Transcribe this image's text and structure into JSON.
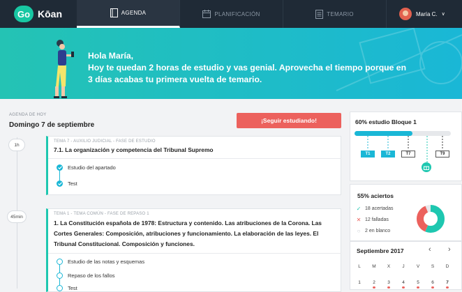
{
  "brand": {
    "badge": "Go",
    "name": "Kōan"
  },
  "nav": {
    "tabs": [
      {
        "label": "AGENDA",
        "icon": "book-icon",
        "active": true
      },
      {
        "label": "PLANIFICACIÓN",
        "icon": "calendar-icon",
        "active": false
      },
      {
        "label": "TEMARIO",
        "icon": "document-list-icon",
        "active": false
      }
    ],
    "user": {
      "name": "María C.",
      "caret": "∨"
    }
  },
  "hero": {
    "line1": "Hola María,",
    "line2": "Hoy te quedan 2 horas de estudio y vas genial. Aprovecha el tiempo porque en",
    "line3": "3 días acabas tu primera vuelta de temario."
  },
  "agenda": {
    "subtitle": "AGENDA DE HOY",
    "date": "Domingo 7 de septiembre",
    "continue_button": "¡Seguir estudiando!"
  },
  "sessions": [
    {
      "time": "1h",
      "meta": "TEMA 7 - AUXILIO JUDICIAL - FASE DE ESTUDIO",
      "title": "7.1.  La organización y competencia del Tribunal Supremo",
      "tasks": [
        {
          "label": "Estudio del apartado",
          "done": true
        },
        {
          "label": "Test",
          "done": true
        }
      ]
    },
    {
      "time": "45min",
      "meta": "TEMA 1 - TEMA COMÚN - FASE DE REPASO 1",
      "title_lines": [
        "1. La Constitución española de 1978: Estructura y contenido. Las atribuciones de la Corona. Las",
        "Cortes Generales: Composición, atribuciones y funcionamiento. La elaboración de las leyes. El",
        "Tribunal Constitucional. Composición y funciones."
      ],
      "tasks": [
        {
          "label": "Estudio de las notas y esquemas",
          "done": false
        },
        {
          "label": "Repaso de los fallos",
          "done": false
        },
        {
          "label": "Test",
          "done": false
        }
      ]
    }
  ],
  "study_progress": {
    "title": "60% estudio Bloque 1",
    "percent": 60,
    "milestones": [
      "T1",
      "T2",
      "T7",
      "T9"
    ],
    "accent": "#1ab7d6"
  },
  "accuracy": {
    "title": "55% aciertos",
    "correct": "18 acertadas",
    "failed": "12 falladas",
    "blank": "2 en blanco",
    "chart_data": {
      "type": "pie",
      "categories": [
        "acertadas",
        "falladas",
        "en blanco"
      ],
      "values": [
        18,
        12,
        2
      ],
      "colors": [
        "#1ec7b0",
        "#ec615d",
        "#e6e8eb"
      ]
    }
  },
  "calendar": {
    "month": "Septiembre 2017",
    "weekdays": [
      "L",
      "M",
      "X",
      "J",
      "V",
      "S",
      "D"
    ],
    "first_row": [
      "1",
      "2",
      "3",
      "4",
      "5",
      "6",
      "7"
    ]
  },
  "colors": {
    "teal": "#1ec7b0",
    "blue": "#1ab7d6",
    "red": "#ec615d",
    "nav": "#1f2a36"
  }
}
